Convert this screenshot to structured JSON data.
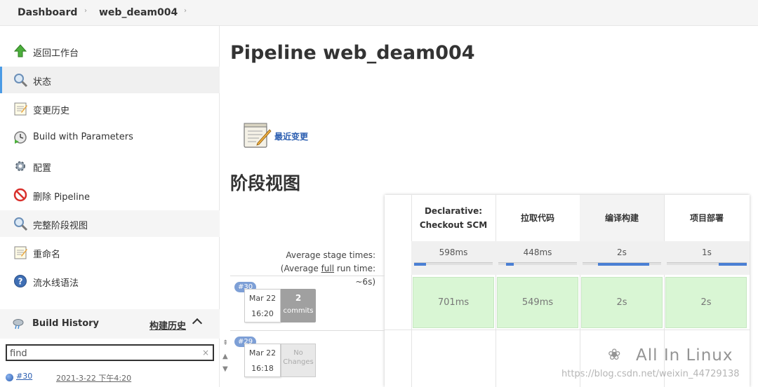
{
  "breadcrumb": {
    "items": [
      "Dashboard",
      "web_deam004"
    ]
  },
  "sidebar": {
    "items": [
      {
        "label": "返回工作台",
        "icon": "up-arrow-icon"
      },
      {
        "label": "状态",
        "icon": "magnifier-icon"
      },
      {
        "label": "变更历史",
        "icon": "notepad-icon"
      },
      {
        "label": "Build with Parameters",
        "icon": "clock-play-icon"
      },
      {
        "label": "配置",
        "icon": "gear-icon"
      },
      {
        "label": "删除 Pipeline",
        "icon": "prohibit-icon"
      },
      {
        "label": "完整阶段视图",
        "icon": "magnifier-icon"
      },
      {
        "label": "重命名",
        "icon": "notepad-icon"
      },
      {
        "label": "流水线语法",
        "icon": "help-icon"
      }
    ]
  },
  "build_history": {
    "title": "Build History",
    "link": "构建历史",
    "find_value": "find",
    "rows": [
      {
        "number": "#30",
        "date": "2021-3-22 下午4:20"
      }
    ]
  },
  "main": {
    "title": "Pipeline web_deam004",
    "changes_link": "最近变更",
    "stage_view_title": "阶段视图",
    "avg_label_line1": "Average stage times:",
    "avg_label_line2_pre": "(Average ",
    "avg_label_line2_link": "full",
    "avg_label_line2_post": " run time: ~6s)"
  },
  "stages": {
    "headers": [
      "Declarative: Checkout SCM",
      "拉取代码",
      "编译构建",
      "项目部署"
    ],
    "averages": [
      "598ms",
      "448ms",
      "2s",
      "1s"
    ],
    "average_fill": [
      0.15,
      0.1,
      0.65,
      0.35
    ],
    "build30": [
      "701ms",
      "549ms",
      "2s",
      "2s"
    ]
  },
  "builds": [
    {
      "badge": "#30",
      "day": "Mar 22",
      "time": "16:20",
      "commits_num": "2",
      "commits_text": "commits"
    },
    {
      "badge": "#29",
      "day": "Mar 22",
      "time": "16:18",
      "no_changes": "No Changes"
    }
  ],
  "watermark": {
    "brand": "All In Linux",
    "url": "https://blog.csdn.net/weixin_44729138"
  },
  "colors": {
    "success_cell": "#d9f6d4",
    "accent_blue": "#4a7fd4",
    "link": "#2a5db0"
  }
}
